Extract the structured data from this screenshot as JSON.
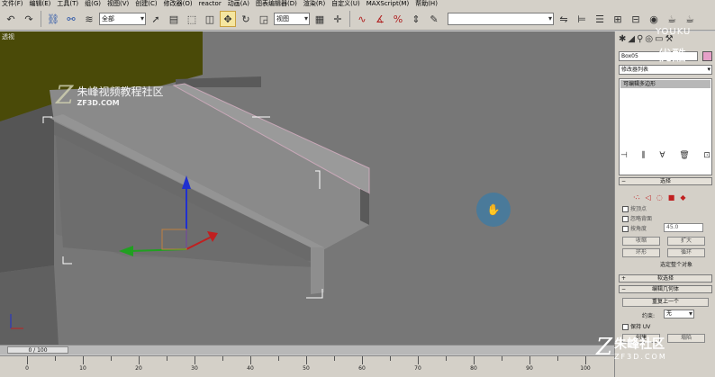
{
  "menu": [
    "文件(F)",
    "编辑(E)",
    "工具(T)",
    "组(G)",
    "视图(V)",
    "创建(C)",
    "修改器(O)",
    "reactor",
    "动画(A)",
    "图表编辑器(D)",
    "渲染(R)",
    "自定义(U)",
    "MAXScript(M)",
    "帮助(H)"
  ],
  "toolbar": {
    "selection_filter": "全部",
    "reference_coord": "视图"
  },
  "viewport": {
    "label": "透视"
  },
  "logo": {
    "title": "朱峰视频教程社区",
    "site": "ZF3D.COM"
  },
  "timeslider": {
    "frame": "0 / 100"
  },
  "track": {
    "ticks": [
      0,
      10,
      20,
      30,
      40,
      50,
      60,
      70,
      80,
      90,
      100
    ]
  },
  "command_panel": {
    "object_name": "Box05",
    "modifier_list": "修改器列表",
    "stack_item": "可编辑多边形",
    "selection_rollout": "选择",
    "by_vertex": "按顶点",
    "ignore_backfacing": "忽略背面",
    "by_angle": "按角度",
    "angle_value": "45.0",
    "shrink": "收缩",
    "grow": "扩大",
    "ring": "环形",
    "loop": "循环",
    "select_whole": "选定整个对象",
    "soft_selection": "软选择",
    "edit_geometry": "编辑几何体",
    "repeat_last": "重复上一个",
    "constraint_label": "约束:",
    "constraint_value": "无",
    "preserve_uv": "保持 UV",
    "create": "创建",
    "collapse": "塌陷"
  },
  "colors": {
    "viewport_bg": "#777777",
    "selection_bracket": "#ffffff",
    "gizmo_y": "#2030d0",
    "gizmo_x": "#c02020",
    "gizmo_z": "#20a020"
  },
  "watermarks": {
    "youku_en": "YOUKU",
    "youku_cn": "优酷",
    "zf_title": "朱峰社区",
    "zf_site": "ZF3D.COM"
  }
}
